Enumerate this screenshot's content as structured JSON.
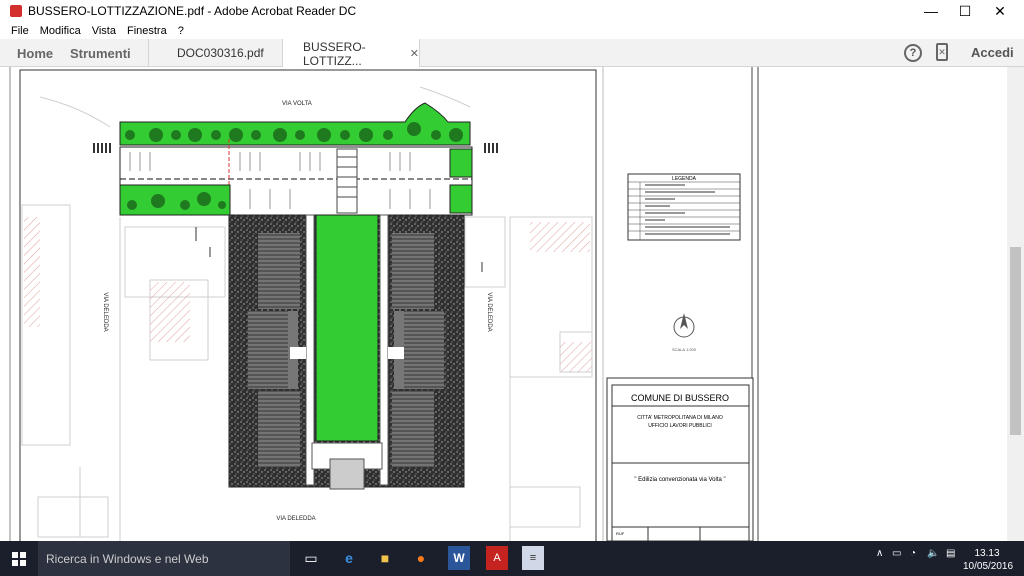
{
  "window": {
    "title": "BUSSERO-LOTTIZZAZIONE.pdf - Adobe Acrobat Reader DC",
    "minimize": "—",
    "maximize": "☐",
    "close": "✕"
  },
  "menu": [
    "File",
    "Modifica",
    "Vista",
    "Finestra",
    "?"
  ],
  "tabs": {
    "home": "Home",
    "tools": "Strumenti",
    "doc1": "DOC030316.pdf",
    "doc2": "BUSSERO-LOTTIZZ...",
    "close": "✕"
  },
  "toolbar": {
    "help": "?",
    "accedi": "Accedi"
  },
  "drawing": {
    "street_top": "VIA VOLTA",
    "street_left": "VIA DELEDDA",
    "street_right": "VIA DELEDDA",
    "street_bottom": "VIA DELEDDA",
    "legend_title": "LEGENDA",
    "scale": "SCALA 1:200",
    "titleblock_title": "COMUNE DI BUSSERO",
    "titleblock_sub1": "CITTA' METROPOLITANA DI MILANO",
    "titleblock_sub2": "UFFICIO LAVORI PUBBLICI",
    "titleblock_project": "\" Edilizia convenzionata via Volta \"",
    "titleblock_ruf": "RUF"
  },
  "taskbar": {
    "search": "Ricerca in Windows e nel Web",
    "time": "13.13",
    "date": "10/05/2016"
  },
  "colors": {
    "green": "#33cc33",
    "gravel": "#3a3a3a",
    "red": "#dd3333",
    "taskbar": "#1a1f2b"
  }
}
